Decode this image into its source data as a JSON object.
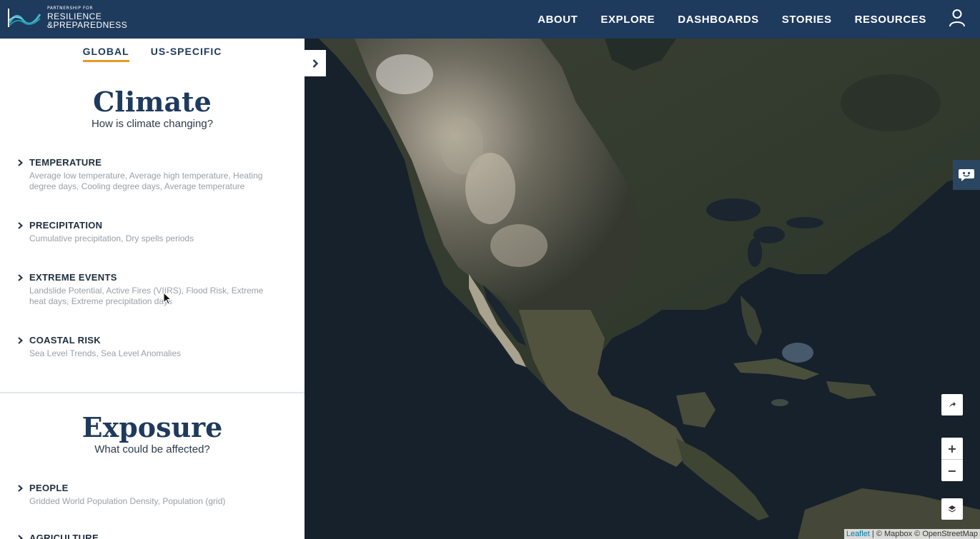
{
  "header": {
    "logo_small": "PARTNERSHIP FOR",
    "logo_line1": "RESILIENCE",
    "logo_line2": "&PREPAREDNESS",
    "nav": [
      "ABOUT",
      "EXPLORE",
      "DASHBOARDS",
      "STORIES",
      "RESOURCES"
    ],
    "icons": {
      "user": "user-icon"
    }
  },
  "sidebar": {
    "tabs": [
      {
        "label": "GLOBAL",
        "active": true
      },
      {
        "label": "US-SPECIFIC",
        "active": false
      }
    ],
    "sections": [
      {
        "title": "Climate",
        "subtitle": "How is climate changing?",
        "categories": [
          {
            "title": "TEMPERATURE",
            "desc": "Average low temperature, Average high temperature, Heating degree days, Cooling degree days, Average temperature"
          },
          {
            "title": "PRECIPITATION",
            "desc": "Cumulative precipitation, Dry spells periods"
          },
          {
            "title": "EXTREME EVENTS",
            "desc": "Landslide Potential, Active Fires (VIIRS), Flood Risk, Extreme heat days, Extreme precipitation days"
          },
          {
            "title": "COASTAL RISK",
            "desc": "Sea Level Trends, Sea Level Anomalies"
          }
        ]
      },
      {
        "title": "Exposure",
        "subtitle": "What could be affected?",
        "categories": [
          {
            "title": "PEOPLE",
            "desc": "Gridded World Population Density, Population (grid)"
          },
          {
            "title": "AGRICULTURE",
            "desc": ""
          }
        ]
      }
    ]
  },
  "map": {
    "zoom_in": "+",
    "zoom_out": "−",
    "attribution_leaflet": "Leaflet",
    "attribution_rest": " | © Mapbox © OpenStreetMap"
  },
  "colors": {
    "header": "#1e3a5c",
    "accent": "#e59a22",
    "ocean": "#17212c"
  }
}
